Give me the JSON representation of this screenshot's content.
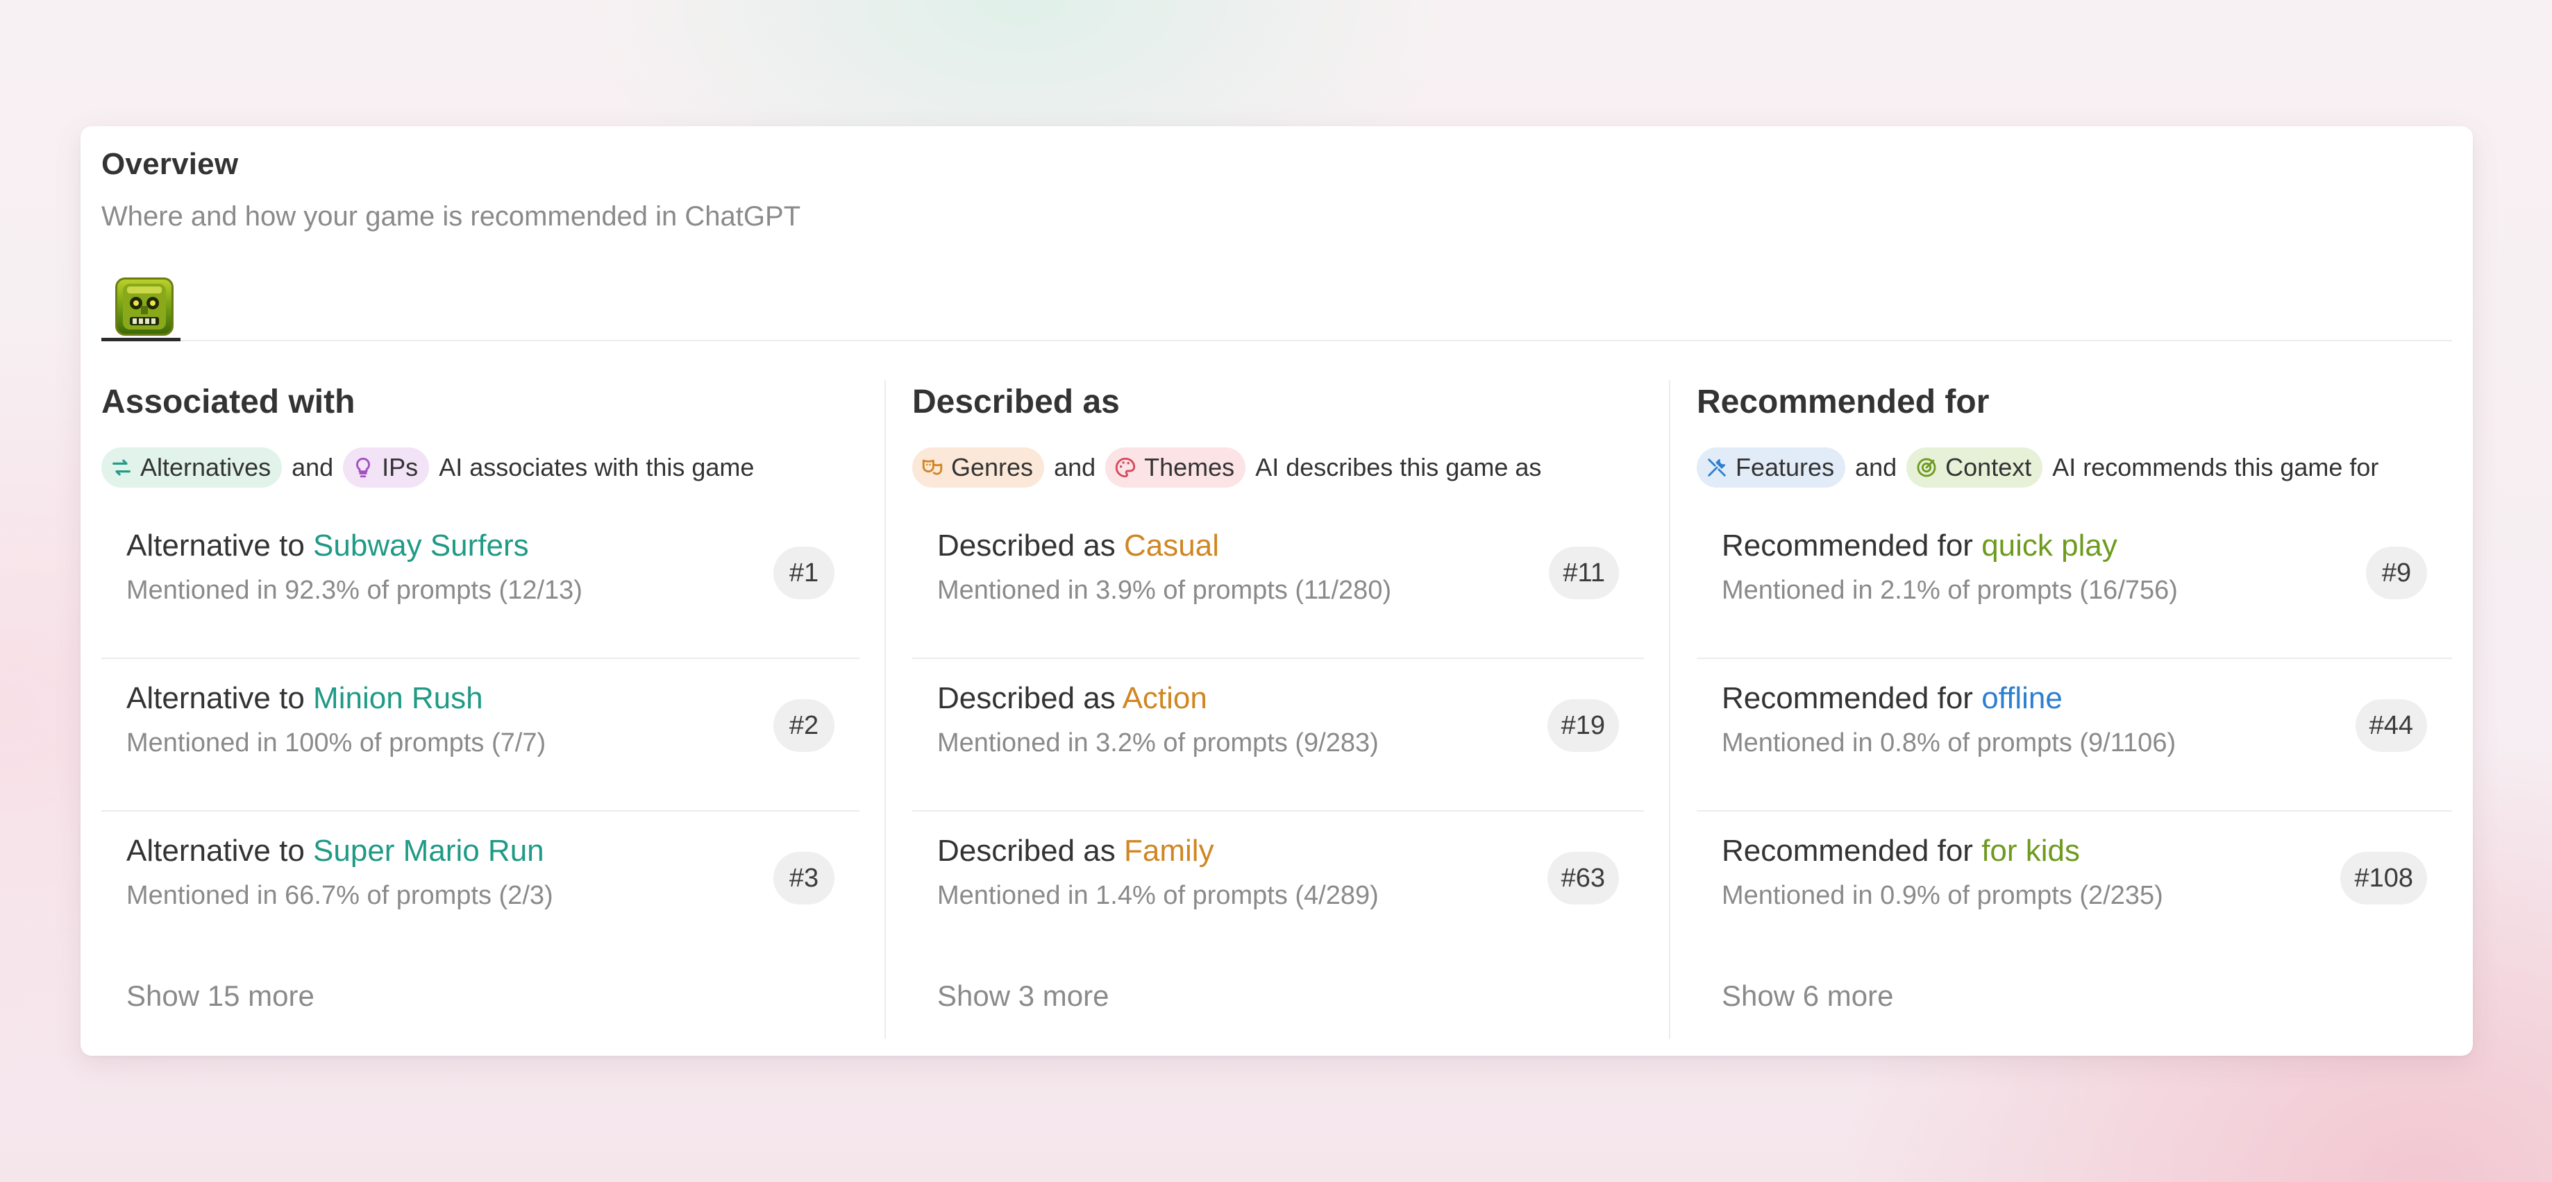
{
  "overview": {
    "title": "Overview",
    "subtitle": "Where and how your game is recommended in ChatGPT"
  },
  "game_tab": {
    "icon": "game-temple-icon"
  },
  "columns": [
    {
      "title": "Associated with",
      "tags": [
        {
          "label": "Alternatives",
          "icon": "swap-arrows-icon",
          "color": "#1f9a86"
        },
        {
          "label": "IPs",
          "icon": "lightbulb-icon",
          "color": "#a24fc0"
        }
      ],
      "and": "and",
      "suffix": "AI associates with this game",
      "items": [
        {
          "prefix": "Alternative to",
          "highlight": "Subway Surfers",
          "mentions": "Mentioned in 92.3% of prompts (12/13)",
          "rank": "#1"
        },
        {
          "prefix": "Alternative to",
          "highlight": "Minion Rush",
          "mentions": "Mentioned in 100% of prompts (7/7)",
          "rank": "#2"
        },
        {
          "prefix": "Alternative to",
          "highlight": "Super Mario Run",
          "mentions": "Mentioned in 66.7% of prompts (2/3)",
          "rank": "#3"
        }
      ],
      "more": "Show 15 more"
    },
    {
      "title": "Described as",
      "tags": [
        {
          "label": "Genres",
          "icon": "masks-icon",
          "color": "#d08622"
        },
        {
          "label": "Themes",
          "icon": "palette-icon",
          "color": "#d4485a"
        }
      ],
      "and": "and",
      "suffix": "AI describes this game as",
      "items": [
        {
          "prefix": "Described as",
          "highlight": "Casual",
          "mentions": "Mentioned in 3.9% of prompts (11/280)",
          "rank": "#11"
        },
        {
          "prefix": "Described as",
          "highlight": "Action",
          "mentions": "Mentioned in 3.2% of prompts (9/283)",
          "rank": "#19"
        },
        {
          "prefix": "Described as",
          "highlight": "Family",
          "mentions": "Mentioned in 1.4% of prompts (4/289)",
          "rank": "#63"
        }
      ],
      "more": "Show 3 more"
    },
    {
      "title": "Recommended for",
      "tags": [
        {
          "label": "Features",
          "icon": "tools-icon",
          "color": "#2d7fd0"
        },
        {
          "label": "Context",
          "icon": "target-icon",
          "color": "#6e9a1e"
        }
      ],
      "and": "and",
      "suffix": "AI recommends this game for",
      "items": [
        {
          "prefix": "Recommended for",
          "highlight": "quick play",
          "mentions": "Mentioned in 2.1% of prompts (16/756)",
          "rank": "#9"
        },
        {
          "prefix": "Recommended for",
          "highlight": "offline",
          "mentions": "Mentioned in 0.8% of prompts (9/1106)",
          "rank": "#44"
        },
        {
          "prefix": "Recommended for",
          "highlight": "for kids",
          "mentions": "Mentioned in 0.9% of prompts (2/235)",
          "rank": "#108"
        }
      ],
      "more": "Show 6 more"
    }
  ]
}
